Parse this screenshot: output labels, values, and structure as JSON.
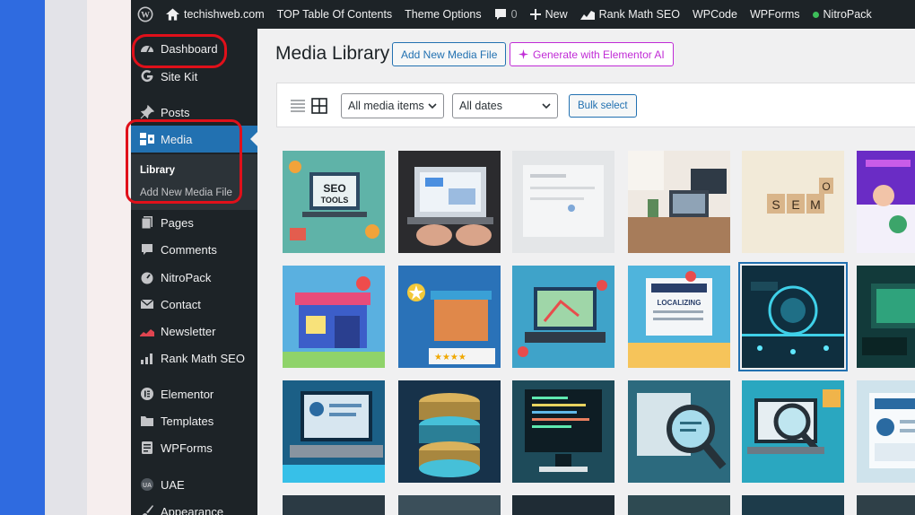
{
  "adminbar": {
    "site_name": "techishweb.com",
    "items": [
      "TOP Table Of Contents",
      "Theme Options",
      "0",
      "New",
      "Rank Math SEO",
      "WPCode",
      "WPForms",
      "NitroPack"
    ]
  },
  "sidebar": {
    "items": [
      {
        "label": "Dashboard",
        "icon": "dashboard-icon"
      },
      {
        "label": "Site Kit",
        "icon": "google-g-icon"
      },
      {
        "label": "Posts",
        "icon": "pin-icon"
      },
      {
        "label": "Media",
        "icon": "media-icon"
      },
      {
        "label": "Pages",
        "icon": "pages-icon"
      },
      {
        "label": "Comments",
        "icon": "comment-icon"
      },
      {
        "label": "NitroPack",
        "icon": "gauge-icon"
      },
      {
        "label": "Contact",
        "icon": "envelope-icon"
      },
      {
        "label": "Newsletter",
        "icon": "newsletter-icon"
      },
      {
        "label": "Rank Math SEO",
        "icon": "chart-icon"
      },
      {
        "label": "Elementor",
        "icon": "elementor-icon"
      },
      {
        "label": "Templates",
        "icon": "folder-icon"
      },
      {
        "label": "WPForms",
        "icon": "wpforms-icon"
      },
      {
        "label": "UAE",
        "icon": "uae-icon"
      },
      {
        "label": "Appearance",
        "icon": "brush-icon"
      }
    ],
    "submenu": {
      "library": "Library",
      "add_new": "Add New Media File"
    }
  },
  "main": {
    "title": "Media Library",
    "add_new_button": "Add New Media File",
    "ai_button": "Generate with Elementor AI",
    "filter_type": "All media items",
    "filter_date": "All dates",
    "bulk_select": "Bulk select"
  },
  "colors": {
    "accent": "#2271b1",
    "admin_dark": "#1d2327",
    "annotation_red": "#e0101a",
    "elementor_pink": "#c02bd6"
  },
  "grid": [
    [
      "seo-tools-laptop",
      "hands-on-laptop",
      "blank-dashboard",
      "desk-workspace",
      "seo-wooden-blocks",
      "purple-profiles"
    ],
    [
      "blue-shop-pin",
      "shop-star-reviews",
      "map-laptop",
      "localizing-content",
      "cyber-pins-selected",
      "green-tech"
    ],
    [
      "wordpress-laptop",
      "database-stack",
      "code-monitor",
      "magnifier-code",
      "magnifier-laptop",
      "wordpress-screen"
    ]
  ],
  "grid_selected": "cyber-pins-selected"
}
